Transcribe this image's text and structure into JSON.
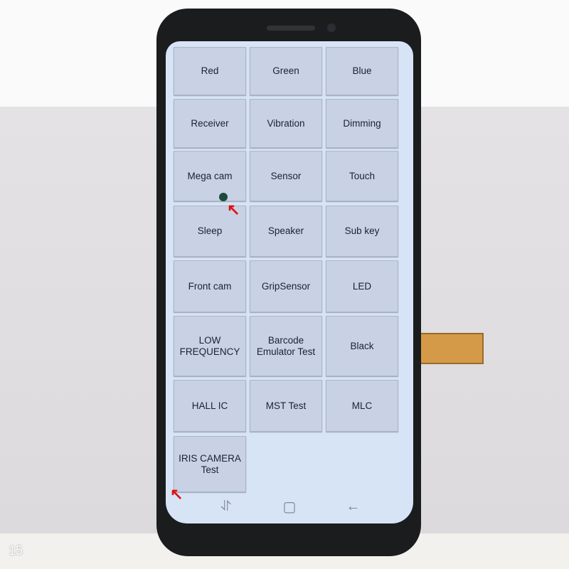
{
  "menu": {
    "buttons": [
      "Red",
      "Green",
      "Blue",
      "Receiver",
      "Vibration",
      "Dimming",
      "Mega cam",
      "Sensor",
      "Touch",
      "Sleep",
      "Speaker",
      "Sub key",
      "Front cam",
      "GripSensor",
      "LED",
      "LOW FREQUENCY",
      "Barcode Emulator Test",
      "Black",
      "HALL IC",
      "MST Test",
      "MLC",
      "IRIS CAMERA Test"
    ]
  },
  "navbar": {
    "icons": [
      "recent-apps-icon",
      "home-icon",
      "back-icon"
    ]
  },
  "overlay": {
    "frame_number": "15",
    "annotation_color": "#e01010"
  }
}
